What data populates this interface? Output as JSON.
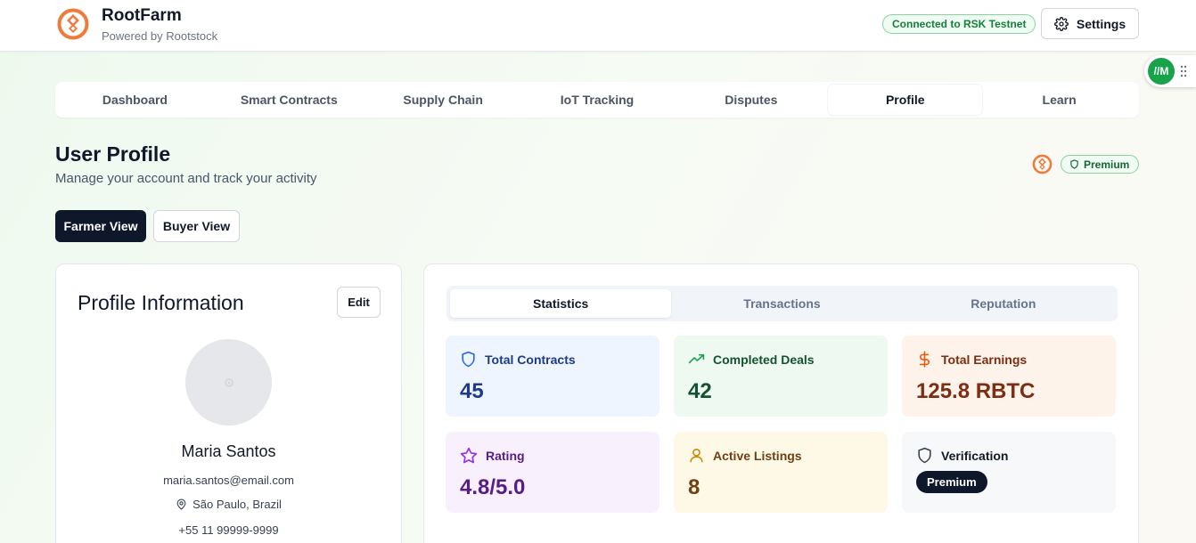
{
  "header": {
    "brand_name": "RootFarm",
    "brand_sub": "Powered by Rootstock",
    "connection_status": "Connected to RSK Testnet",
    "settings_label": "Settings",
    "wallet_widget_label": "//M"
  },
  "nav": {
    "tabs": [
      {
        "label": "Dashboard"
      },
      {
        "label": "Smart Contracts"
      },
      {
        "label": "Supply Chain"
      },
      {
        "label": "IoT Tracking"
      },
      {
        "label": "Disputes"
      },
      {
        "label": "Profile",
        "active": true
      },
      {
        "label": "Learn"
      }
    ]
  },
  "page": {
    "title": "User Profile",
    "subtitle": "Manage your account and track your activity",
    "tier_badge": "Premium",
    "views": {
      "farmer": "Farmer View",
      "buyer": "Buyer View"
    }
  },
  "profile": {
    "heading": "Profile Information",
    "edit_label": "Edit",
    "name": "Maria Santos",
    "email": "maria.santos@email.com",
    "location": "São Paulo, Brazil",
    "phone": "+55 11 99999-9999"
  },
  "stats_panel": {
    "tabs": [
      {
        "label": "Statistics",
        "active": true
      },
      {
        "label": "Transactions"
      },
      {
        "label": "Reputation"
      }
    ],
    "cards": {
      "total_contracts": {
        "label": "Total Contracts",
        "value": "45"
      },
      "completed_deals": {
        "label": "Completed Deals",
        "value": "42"
      },
      "total_earnings": {
        "label": "Total Earnings",
        "value": "125.8 RBTC"
      },
      "rating": {
        "label": "Rating",
        "value": "4.8/5.0"
      },
      "active_listings": {
        "label": "Active Listings",
        "value": "8"
      },
      "verification": {
        "label": "Verification",
        "value": "Premium"
      }
    }
  },
  "colors": {
    "brand_orange": "#f07a3c",
    "accent_green": "#15803d",
    "dark": "#0f172a"
  },
  "icons": {
    "logo": "rootstock-logo-icon",
    "settings": "gear-icon",
    "location": "map-pin-icon",
    "contracts": "shield-icon",
    "deals": "trending-up-icon",
    "earnings": "dollar-icon",
    "rating": "star-icon",
    "listings": "user-icon",
    "verification": "shield-icon"
  }
}
